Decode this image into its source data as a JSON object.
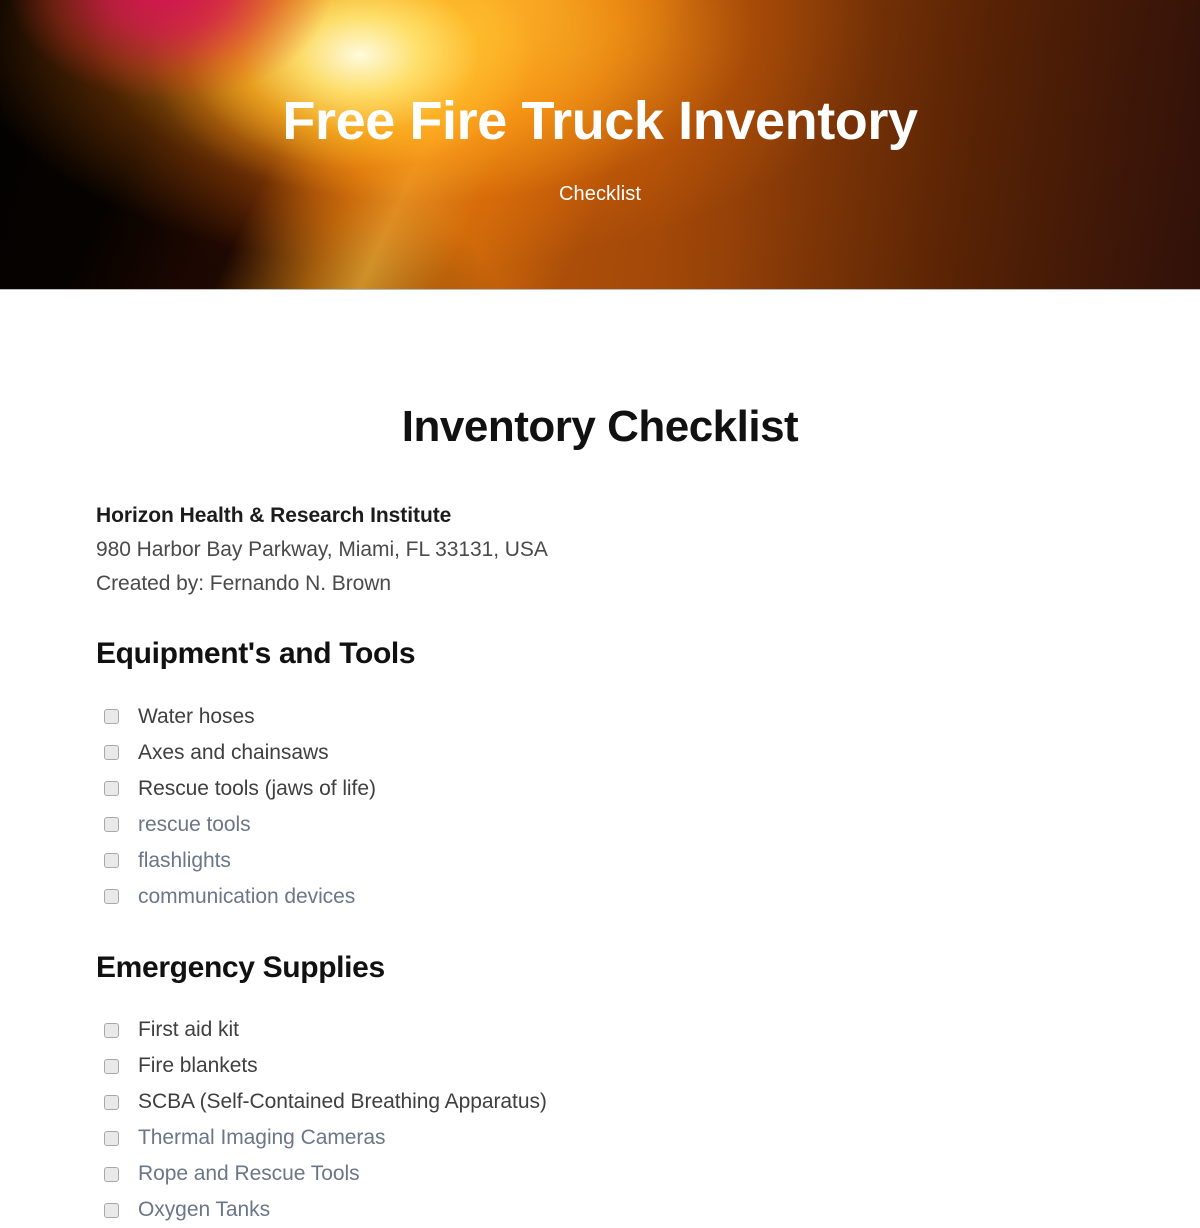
{
  "banner": {
    "title": "Free Fire Truck Inventory",
    "subtitle": "Checklist",
    "colors": {
      "crimson": "#d81256",
      "glow_core": "#fffce0",
      "amber": "#ffba38",
      "orange": "#b5540a",
      "dark_brown": "#42170a",
      "black": "#020100",
      "title_text": "#ffffff"
    }
  },
  "document": {
    "title": "Inventory Checklist",
    "organization": "Horizon Health & Research Institute",
    "address": "980 Harbor Bay Parkway, Miami, FL 33131, USA",
    "created_by": "Created by: Fernando N. Brown",
    "text_colors": {
      "heading": "#111111",
      "body": "#4a4a4a",
      "item_dark": "#3f3f3f",
      "item_muted": "#6b7689",
      "checkbox_fill": "#e9e9e9",
      "checkbox_border": "#a8a8a8"
    }
  },
  "sections": [
    {
      "heading": "Equipment's and Tools",
      "items": [
        {
          "label": "Water hoses",
          "tone": "dark",
          "checked": false
        },
        {
          "label": "Axes and chainsaws",
          "tone": "dark",
          "checked": false
        },
        {
          "label": "Rescue tools (jaws of life)",
          "tone": "dark",
          "checked": false
        },
        {
          "label": "rescue tools",
          "tone": "muted",
          "checked": false
        },
        {
          "label": "flashlights",
          "tone": "muted",
          "checked": false
        },
        {
          "label": "communication devices",
          "tone": "muted",
          "checked": false
        }
      ]
    },
    {
      "heading": "Emergency Supplies",
      "items": [
        {
          "label": "First aid kit",
          "tone": "dark",
          "checked": false
        },
        {
          "label": "Fire blankets",
          "tone": "dark",
          "checked": false
        },
        {
          "label": "SCBA (Self-Contained Breathing Apparatus)",
          "tone": "dark",
          "checked": false
        },
        {
          "label": "Thermal Imaging Cameras",
          "tone": "muted",
          "checked": false
        },
        {
          "label": "Rope and Rescue Tools",
          "tone": "muted",
          "checked": false
        },
        {
          "label": "Oxygen Tanks",
          "tone": "muted",
          "checked": false
        }
      ]
    }
  ]
}
